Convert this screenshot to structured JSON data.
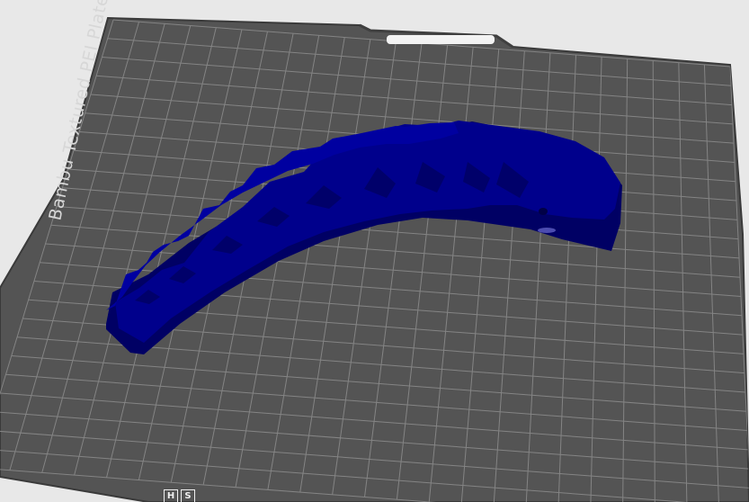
{
  "scene": {
    "plate_label": "Bambu Textured PEI Plate",
    "badge_glyphs": [
      "H",
      "S"
    ]
  },
  "colors": {
    "background": "#e8e8e8",
    "plate": "#545454",
    "plate_grid": "#8d8d8d",
    "model": "#00008c",
    "model_dark": "#000064"
  }
}
